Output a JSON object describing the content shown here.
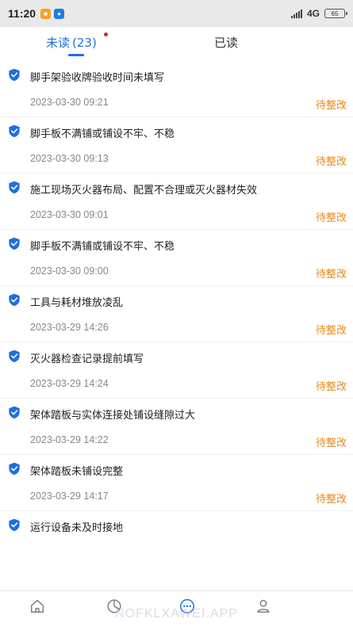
{
  "status_bar": {
    "time": "11:20",
    "network": "4G",
    "battery": "65"
  },
  "tabs": {
    "unread_label": "未读",
    "unread_count": "(23)",
    "read_label": "已读"
  },
  "notifications": [
    {
      "title": "脚手架验收牌验收时间未填写",
      "time": "2023-03-30 09:21",
      "status": "待整改"
    },
    {
      "title": "脚手板不满铺或铺设不牢、不稳",
      "time": "2023-03-30 09:13",
      "status": "待整改"
    },
    {
      "title": "施工现场灭火器布局、配置不合理或灭火器材失效",
      "time": "2023-03-30 09:01",
      "status": "待整改"
    },
    {
      "title": "脚手板不满铺或铺设不牢、不稳",
      "time": "2023-03-30 09:00",
      "status": "待整改"
    },
    {
      "title": "工具与耗材堆放凌乱",
      "time": "2023-03-29 14:26",
      "status": "待整改"
    },
    {
      "title": "灭火器检查记录提前填写",
      "time": "2023-03-29 14:24",
      "status": "待整改"
    },
    {
      "title": "架体踏板与实体连接处铺设缝隙过大",
      "time": "2023-03-29 14:22",
      "status": "待整改"
    },
    {
      "title": "架体踏板未铺设完整",
      "time": "2023-03-29 14:17",
      "status": "待整改"
    },
    {
      "title": "运行设备未及时接地",
      "time": "",
      "status": ""
    }
  ],
  "bottom_nav": {
    "icons": [
      "home-icon",
      "stats-icon",
      "message-icon",
      "user-icon"
    ]
  },
  "watermark": "NOFKLXAWEI.APP",
  "colors": {
    "accent": "#1d6fe0",
    "status_pending": "#e88a16",
    "badge_dot": "#e02020"
  }
}
